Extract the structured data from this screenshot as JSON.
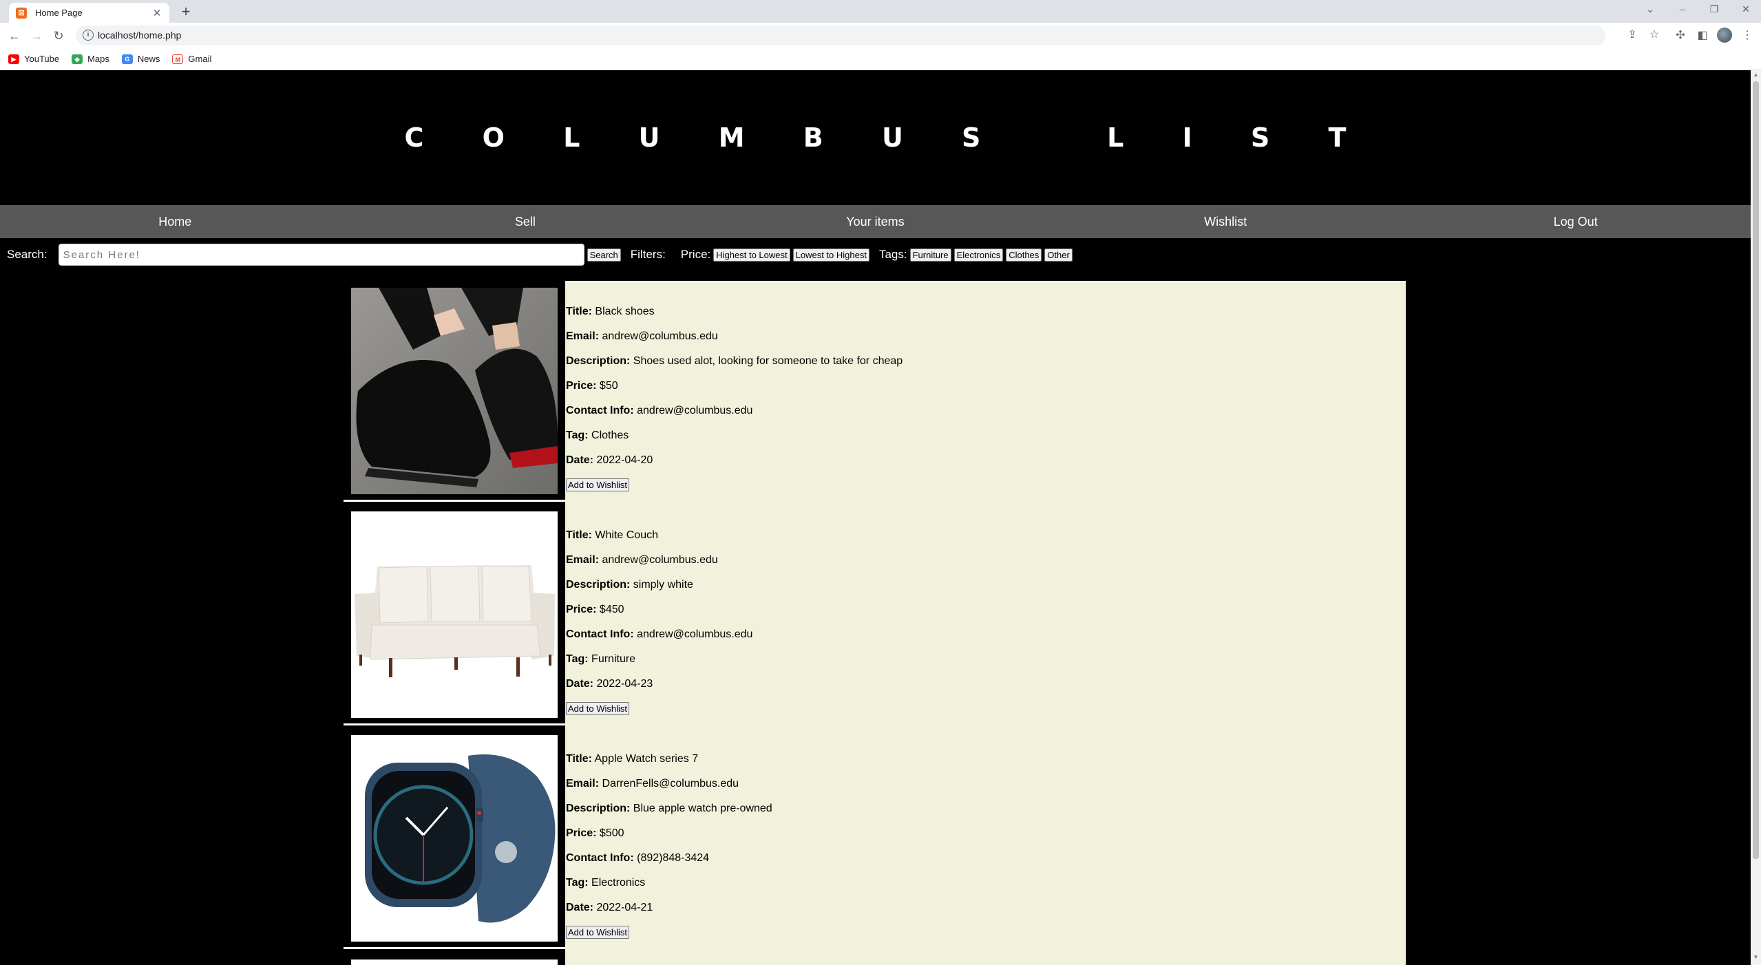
{
  "browser": {
    "tab_title": "Home Page",
    "url": "localhost/home.php",
    "bookmarks": [
      {
        "label": "YouTube",
        "icon": "youtube-icon",
        "color": "#ff0000"
      },
      {
        "label": "Maps",
        "icon": "maps-icon",
        "color": "#34a853"
      },
      {
        "label": "News",
        "icon": "news-icon",
        "color": "#4285f4"
      },
      {
        "label": "Gmail",
        "icon": "gmail-icon",
        "color": "#ea4335"
      }
    ]
  },
  "site": {
    "title": "C O L U M B U S   L I S T"
  },
  "nav": {
    "items": [
      "Home",
      "Sell",
      "Your items",
      "Wishlist",
      "Log Out"
    ]
  },
  "filters": {
    "search_label": "Search:",
    "search_placeholder": "Search Here!",
    "search_button": "Search",
    "filters_label": "Filters:",
    "price_label": "Price:",
    "price_buttons": [
      "Highest to Lowest",
      "Lowest to Highest"
    ],
    "tags_label": "Tags:",
    "tag_buttons": [
      "Furniture",
      "Electronics",
      "Clothes",
      "Other"
    ]
  },
  "labels": {
    "title": "Title:",
    "email": "Email:",
    "description": "Description:",
    "price": "Price:",
    "contact": "Contact Info:",
    "tag": "Tag:",
    "date": "Date:",
    "wishlist_button": "Add to Wishlist"
  },
  "listings": [
    {
      "title": "Black shoes",
      "email": "andrew@columbus.edu",
      "description": "Shoes used alot, looking for someone to take for cheap",
      "price": "$50",
      "contact": "andrew@columbus.edu",
      "tag": "Clothes",
      "date": "2022-04-20"
    },
    {
      "title": "White Couch",
      "email": "andrew@columbus.edu",
      "description": "simply white",
      "price": "$450",
      "contact": "andrew@columbus.edu",
      "tag": "Furniture",
      "date": "2022-04-23"
    },
    {
      "title": "Apple Watch series 7",
      "email": "DarrenFells@columbus.edu",
      "description": "Blue apple watch pre-owned",
      "price": "$500",
      "contact": "(892)848-3424",
      "tag": "Electronics",
      "date": "2022-04-21"
    }
  ],
  "colors": {
    "header_bg": "#000000",
    "nav_bg": "#575757",
    "listing_bg": "#f2f2dc"
  }
}
